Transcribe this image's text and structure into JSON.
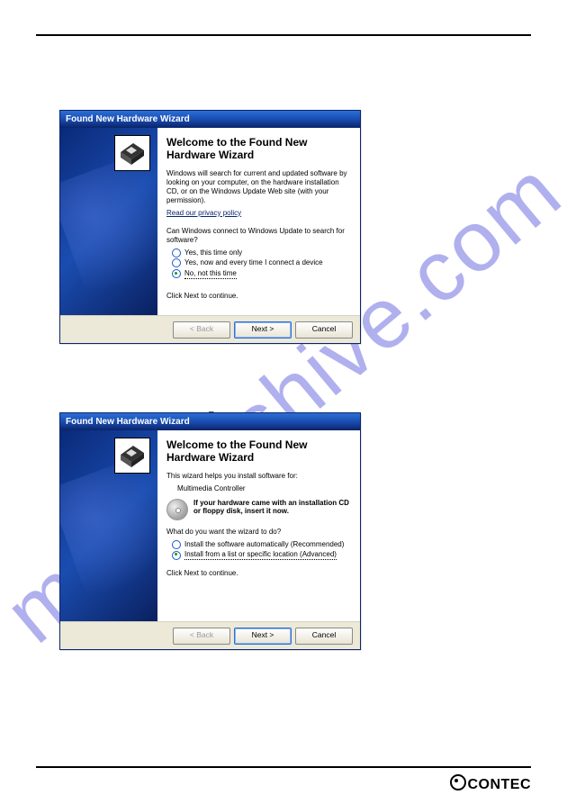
{
  "watermark": "manualshive.com",
  "footer_brand": "CONTEC",
  "separator_dash": "–",
  "dialog1": {
    "title": "Found New Hardware Wizard",
    "heading": "Welcome to the Found New Hardware Wizard",
    "intro": "Windows will search for current and updated software by looking on your computer, on the hardware installation CD, or on the Windows Update Web site (with your permission).",
    "privacy_link": "Read our privacy policy",
    "question": "Can Windows connect to Windows Update to search for software?",
    "options": [
      {
        "label": "Yes, this time only",
        "checked": false
      },
      {
        "label": "Yes, now and every time I connect a device",
        "checked": false
      },
      {
        "label": "No, not this time",
        "checked": true
      }
    ],
    "continue": "Click Next to continue.",
    "buttons": {
      "back": "< Back",
      "next": "Next >",
      "cancel": "Cancel"
    }
  },
  "dialog2": {
    "title": "Found New Hardware Wizard",
    "heading": "Welcome to the Found New Hardware Wizard",
    "intro": "This wizard helps you install software for:",
    "device": "Multimedia Controller",
    "cd_prompt": "If your hardware came with an installation CD or floppy disk, insert it now.",
    "question": "What do you want the wizard to do?",
    "options": [
      {
        "label": "Install the software automatically (Recommended)",
        "checked": false
      },
      {
        "label": "Install from a list or specific location (Advanced)",
        "checked": true
      }
    ],
    "continue": "Click Next to continue.",
    "buttons": {
      "back": "< Back",
      "next": "Next >",
      "cancel": "Cancel"
    }
  }
}
